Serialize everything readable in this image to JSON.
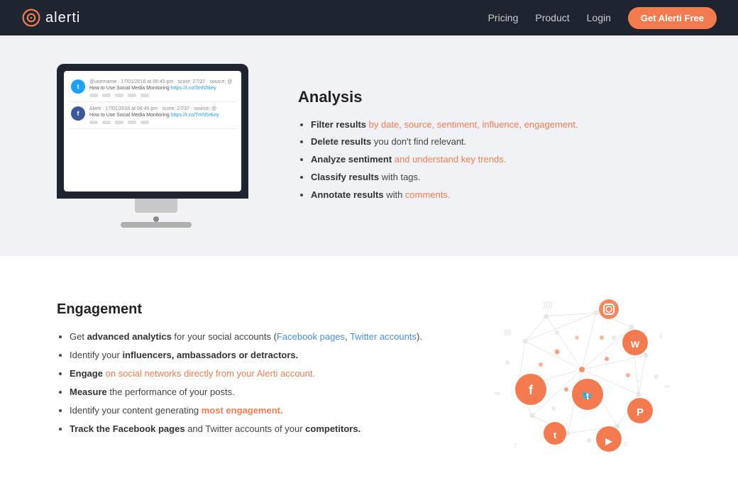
{
  "header": {
    "logo_text": "alerti",
    "nav_items": [
      {
        "label": "Pricing",
        "href": "#"
      },
      {
        "label": "Product",
        "href": "#"
      },
      {
        "label": "Login",
        "href": "#"
      }
    ],
    "cta_label": "Get Alerti Free"
  },
  "analysis": {
    "title": "Analysis",
    "bullets": [
      {
        "bold": "Filter results",
        "rest": " by date, source, sentiment, influence, engagement."
      },
      {
        "bold": "Delete results",
        "rest": " you don't find relevant."
      },
      {
        "bold": "Analyze sentiment",
        "rest": " and understand key trends."
      },
      {
        "bold": "Classify results",
        "rest": " with tags."
      },
      {
        "bold": "Annotate results",
        "rest": " with comments."
      }
    ]
  },
  "engagement": {
    "title": "Engagement",
    "bullets": [
      {
        "bold": "advanced analytics",
        "pre": "Get ",
        "rest": " for your social accounts (Facebook pages, Twitter accounts)."
      },
      {
        "bold": "influencers, ambassadors or detractors.",
        "pre": "Identify your "
      },
      {
        "bold": "on social networks directly from your Alerti account.",
        "pre": "Engage "
      },
      {
        "bold": "the performance of your posts.",
        "pre": "Measure "
      },
      {
        "bold": "most engagement.",
        "pre": "Identify your content generating "
      },
      {
        "bold": "Track the Facebook pages",
        "rest": " and Twitter accounts of your competitors."
      }
    ]
  },
  "colors": {
    "accent": "#f47b50",
    "header_bg": "#1e2530",
    "section1_bg": "#f0f2f5"
  }
}
